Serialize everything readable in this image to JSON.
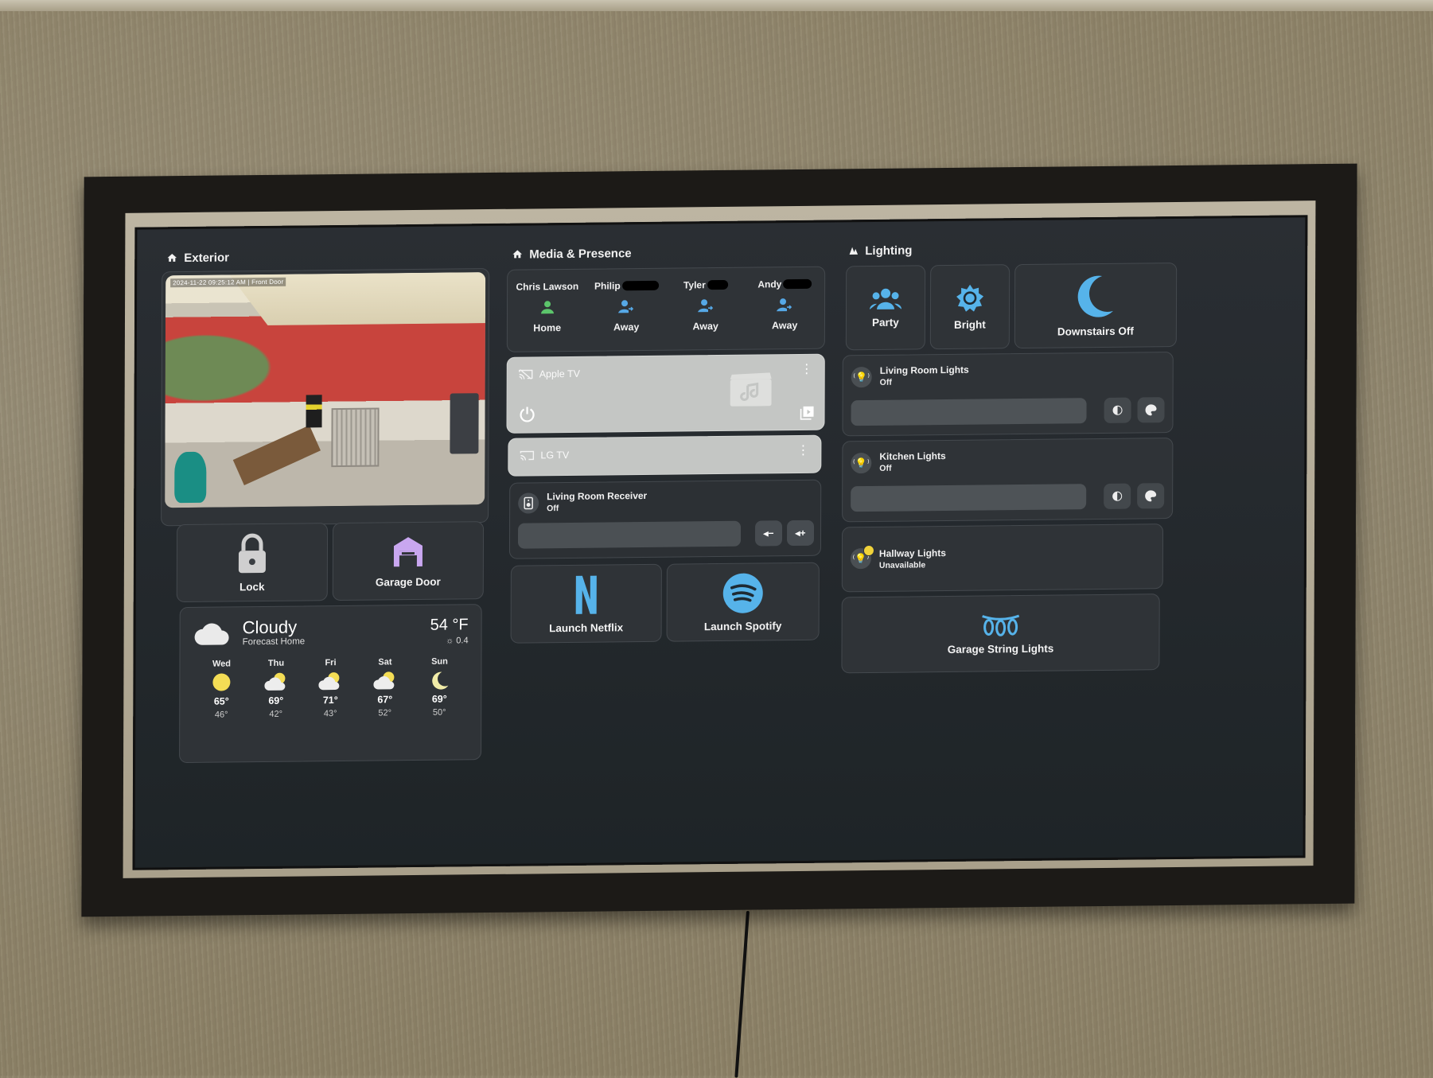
{
  "scene": {
    "wall_color": "#8f8469",
    "frame_color": "#1c1a17",
    "mat_color": "#b3ab96",
    "screen_bg": "#262b2f"
  },
  "dashboard": {
    "accent_blue": "#56a8e6",
    "home_green": "#5cc56b",
    "card_bg": "#2f3337",
    "garage_purple": "#c9a7f0",
    "sun_yellow": "#f4dd55"
  },
  "exterior": {
    "title": "Exterior",
    "title_icon": "home-icon",
    "camera": {
      "timestamp": "2024-11-22 09:25:12 AM",
      "camera_name": "Front Door"
    },
    "tiles": [
      {
        "label": "Lock",
        "icon": "lock-icon"
      },
      {
        "label": "Garage Door",
        "icon": "garage-icon"
      }
    ],
    "weather": {
      "condition": "Cloudy",
      "subtitle": "Forecast Home",
      "temperature": "54 °F",
      "precip_value": "0.4",
      "forecast": [
        {
          "day": "Wed",
          "icon": "sunny-icon",
          "high": "65°",
          "low": "46°"
        },
        {
          "day": "Thu",
          "icon": "partly-cloudy-icon",
          "high": "69°",
          "low": "42°"
        },
        {
          "day": "Fri",
          "icon": "partly-cloudy-icon",
          "high": "71°",
          "low": "43°"
        },
        {
          "day": "Sat",
          "icon": "partly-cloudy-icon",
          "high": "67°",
          "low": "52°"
        },
        {
          "day": "Sun",
          "icon": "clear-night-icon",
          "high": "69°",
          "low": "50°"
        }
      ]
    }
  },
  "media": {
    "title": "Media & Presence",
    "title_icon": "home-icon",
    "people": [
      {
        "name": "Chris Lawson",
        "redacted": false,
        "state": "Home",
        "icon": "account-home-icon"
      },
      {
        "name": "Philip",
        "redacted": true,
        "state": "Away",
        "icon": "account-away-icon"
      },
      {
        "name": "Tyler",
        "redacted": true,
        "state": "Away",
        "icon": "account-away-icon"
      },
      {
        "name": "Andy",
        "redacted": true,
        "state": "Away",
        "icon": "account-away-icon"
      }
    ],
    "players": [
      {
        "name": "Apple TV",
        "icon": "cast-off-icon"
      },
      {
        "name": "LG TV",
        "icon": "cast-off-icon"
      }
    ],
    "receiver": {
      "name": "Living Room Receiver",
      "state": "Off",
      "vol_down": "volume-minus-icon",
      "vol_up": "volume-plus-icon"
    },
    "launchers": [
      {
        "label": "Launch Netflix",
        "icon": "netflix-icon"
      },
      {
        "label": "Launch Spotify",
        "icon": "spotify-icon"
      }
    ]
  },
  "lighting": {
    "title": "Lighting",
    "title_icon": "lightbulb-group-icon",
    "scenes": [
      {
        "label": "Party",
        "icon": "account-group-icon"
      },
      {
        "label": "Bright",
        "icon": "brightness-icon"
      },
      {
        "label": "Downstairs Off",
        "icon": "moon-icon"
      }
    ],
    "lights": [
      {
        "name": "Living Room Lights",
        "state": "Off"
      },
      {
        "name": "Kitchen Lights",
        "state": "Off"
      },
      {
        "name": "Hallway Lights",
        "state": "Unavailable"
      }
    ],
    "string_lights": {
      "label": "Garage String Lights",
      "icon": "string-lights-icon"
    }
  }
}
